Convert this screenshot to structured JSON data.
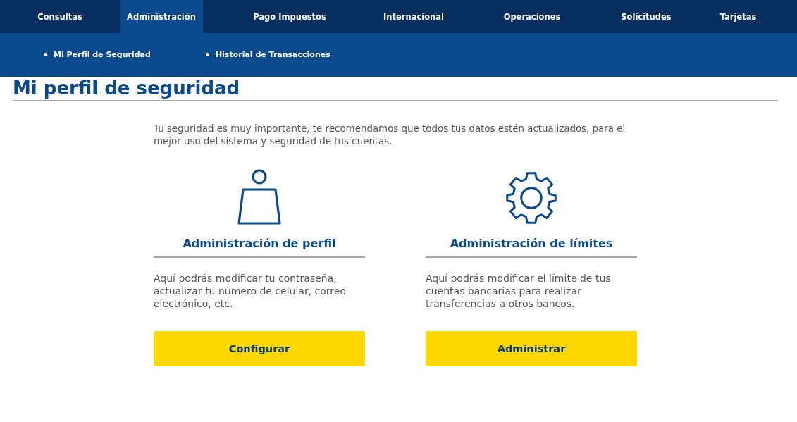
{
  "nav": {
    "tabs": [
      {
        "label": "Consultas",
        "selected": false
      },
      {
        "label": "Administración",
        "selected": true
      },
      {
        "label": "Pago Impuestos",
        "selected": false
      },
      {
        "label": "Internacional",
        "selected": false
      },
      {
        "label": "Operaciones",
        "selected": false
      },
      {
        "label": "Solicitudes",
        "selected": false
      },
      {
        "label": "Tarjetas",
        "selected": false
      }
    ],
    "submenu": [
      "Mi Perfil de Seguridad",
      "Historial de Transacciones"
    ]
  },
  "page_title": "Mi perfil de seguridad",
  "intro": "Tu seguridad es muy importante, te recomendamos que todos tus datos estén actualizados, para el mejor uso del sistema y seguridad de tus cuentas.",
  "cards": [
    {
      "kind": "profile",
      "title": "Administración de perfil",
      "text": "Aquí podrás modificar tu contraseña, actualizar tu número de celular, correo electrónico, etc.",
      "button": "Configurar"
    },
    {
      "kind": "limits",
      "title": "Administración de límites",
      "text": "Aquí podrás modificar el límite de tus cuentas bancarias para realizar transferencias a otros bancos.",
      "button": "Administrar"
    }
  ]
}
